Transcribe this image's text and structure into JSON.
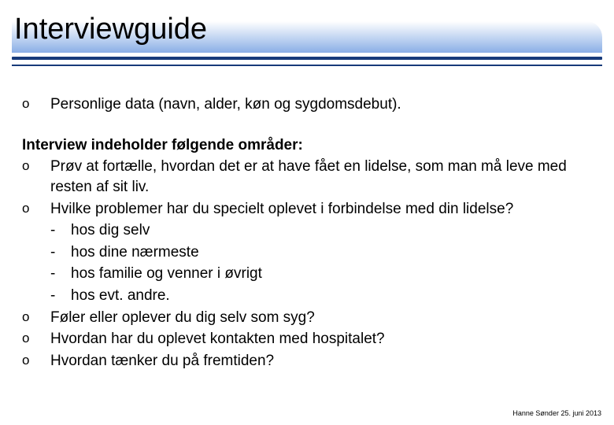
{
  "title": "Interviewguide",
  "intro_bullet": "o",
  "intro": "Personlige data (navn, alder, køn og sygdomsdebut).",
  "section_heading": "Interview indeholder følgende områder:",
  "items": [
    {
      "bullet": "o",
      "text": "Prøv at fortælle, hvordan det er at have fået en lidelse, som man må leve med resten af sit liv."
    },
    {
      "bullet": "o",
      "text": "Hvilke problemer har du specielt oplevet i forbindelse med din lidelse?"
    }
  ],
  "subitems": [
    {
      "dash": "-",
      "text": "hos dig selv"
    },
    {
      "dash": "-",
      "text": "hos dine nærmeste"
    },
    {
      "dash": "-",
      "text": "hos familie og venner i øvrigt"
    },
    {
      "dash": "-",
      "text": "hos evt. andre."
    }
  ],
  "items2": [
    {
      "bullet": "o",
      "text": "Føler eller oplever du dig selv som syg?"
    },
    {
      "bullet": "o",
      "text": "Hvordan har du oplevet kontakten med hospitalet?"
    },
    {
      "bullet": "o",
      "text": "Hvordan tænker du på fremtiden?"
    }
  ],
  "footer": "Hanne Sønder 25. juni 2013"
}
